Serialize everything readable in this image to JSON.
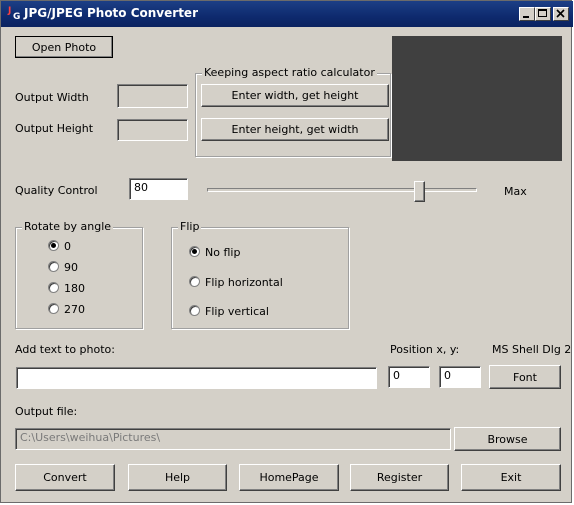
{
  "window": {
    "title": "JPG/JPEG Photo Converter",
    "controls": [
      "minimize-icon",
      "maximize-icon",
      "close-icon"
    ]
  },
  "buttons": {
    "open_photo": "Open Photo",
    "enter_width": "Enter width, get height",
    "enter_height": "Enter height, get width",
    "font": "Font",
    "browse": "Browse",
    "convert": "Convert",
    "help": "Help",
    "homepage": "HomePage",
    "register": "Register",
    "exit": "Exit"
  },
  "size": {
    "output_width_label": "Output Width",
    "output_height_label": "Output Height",
    "output_width_value": "",
    "output_height_value": "",
    "aspect_group_title": "Keeping aspect ratio calculator"
  },
  "quality": {
    "label": "Quality Control",
    "value": "80",
    "max_label": "Max",
    "slider_fraction": 0.8
  },
  "rotate": {
    "title": "Rotate by angle",
    "options": [
      "0",
      "90",
      "180",
      "270"
    ],
    "selected": "0"
  },
  "flip": {
    "title": "Flip",
    "options": [
      "No flip",
      "Flip horizontal",
      "Flip vertical"
    ],
    "selected": "No flip"
  },
  "text_overlay": {
    "label": "Add text to photo:",
    "value": "",
    "position_label": "Position x, y:",
    "pos_x": "0",
    "pos_y": "0",
    "font_name": "MS Shell Dlg 2"
  },
  "output_file": {
    "label": "Output file:",
    "value": "C:\\Users\\weihua\\Pictures\\"
  },
  "colors": {
    "titlebar": "#0e2a6e",
    "face": "#d4d0c8",
    "preview": "#404040"
  }
}
